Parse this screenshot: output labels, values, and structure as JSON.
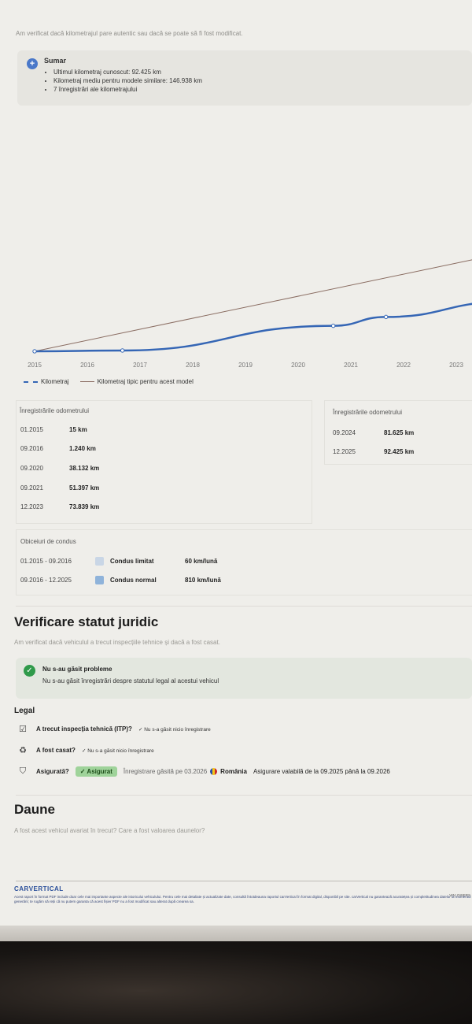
{
  "intro_text": "Am verificat dacă kilometrajul pare autentic sau dacă se poate să fi fost modificat.",
  "summary": {
    "icon": "info-icon",
    "title": "Sumar",
    "items": [
      "Ultimul kilometraj cunoscut: 92.425 km",
      "Kilometraj mediu pentru modele similare: 146.938 km",
      "7 înregistrări ale kilometrajului"
    ]
  },
  "chart_data": {
    "type": "line",
    "categories": [
      "2015",
      "2016",
      "2017",
      "2018",
      "2019",
      "2020",
      "2021",
      "2022",
      "2023"
    ],
    "series": [
      {
        "name": "Kilometraj",
        "style": "dashed-blue",
        "color": "#3566b5",
        "points": [
          {
            "x": "01.2015",
            "y": 15
          },
          {
            "x": "09.2016",
            "y": 1240
          },
          {
            "x": "09.2020",
            "y": 38132
          },
          {
            "x": "09.2021",
            "y": 51397
          },
          {
            "x": "12.2023",
            "y": 73839
          }
        ]
      },
      {
        "name": "Kilometraj tipic pentru acest model",
        "style": "solid",
        "color": "#8a6d62",
        "points": [
          {
            "x": "01.2015",
            "y": 0
          },
          {
            "x": "12.2023",
            "y": 146938
          }
        ]
      }
    ]
  },
  "legend": {
    "odo": "Kilometraj",
    "typical": "Kilometraj tipic pentru acest model"
  },
  "odometer": {
    "title_left": "Înregistrările odometrului",
    "title_right": "Înregistrările odometrului",
    "left": [
      {
        "date": "01.2015",
        "km": "15 km"
      },
      {
        "date": "09.2016",
        "km": "1.240 km"
      },
      {
        "date": "09.2020",
        "km": "38.132 km"
      },
      {
        "date": "09.2021",
        "km": "51.397 km"
      },
      {
        "date": "12.2023",
        "km": "73.839 km"
      }
    ],
    "right": [
      {
        "date": "09.2024",
        "km": "81.625 km"
      },
      {
        "date": "12.2025",
        "km": "92.425 km"
      }
    ]
  },
  "habits": {
    "title": "Obiceiuri de condus",
    "rows": [
      {
        "period": "01.2015 - 09.2016",
        "type": "Condus limitat",
        "rate": "60 km/lună",
        "color": "#c9d6e6"
      },
      {
        "period": "09.2016 - 12.2025",
        "type": "Condus normal",
        "rate": "810 km/lună",
        "color": "#8fb3da"
      }
    ]
  },
  "legal_section": {
    "title": "Verificare statut juridic",
    "subtitle": "Am verificat dacă vehiculul a trecut inspecțiile tehnice și dacă a fost casat.",
    "ok_title": "Nu s-au găsit probleme",
    "ok_text": "Nu s-au găsit înregistrări despre statutul legal al acestui vehicul",
    "legal_label": "Legal",
    "rows": {
      "itp_q": "A trecut inspecția tehnică (ITP)?",
      "itp_a": "✓ Nu s-a găsit nicio înregistrare",
      "casat_q": "A fost casat?",
      "casat_a": "✓ Nu s-a găsit nicio înregistrare",
      "ins_q": "Asigurată?",
      "ins_badge": "✓ Asigurat",
      "ins_found": "Înregistrare găsită pe 03.2026",
      "ins_country": "România",
      "ins_valid": "Asigurare valabilă de la 09.2025 până la 09.2026"
    }
  },
  "damage": {
    "title": "Daune",
    "subtitle": "A fost acest vehicul avariat în trecut? Care a fost valoarea daunelor?"
  },
  "footer": {
    "brand": "CARVERTICAL",
    "vin_label": "VIN: DISERS",
    "text": "Acest raport în format PDF include doar cele mai importante aspecte ale istoricului vehiculului. Pentru cele mai detaliate și actualizate date, consultă întotdeauna raportul carVertical în format digital, disponibil pe site. carVertical nu garantează acuratețea și completitudinea datelor la momentul generării; te rugăm să reții că nu putem garanta că acest fișier PDF nu a fost modificat sau alterat după crearea sa."
  }
}
